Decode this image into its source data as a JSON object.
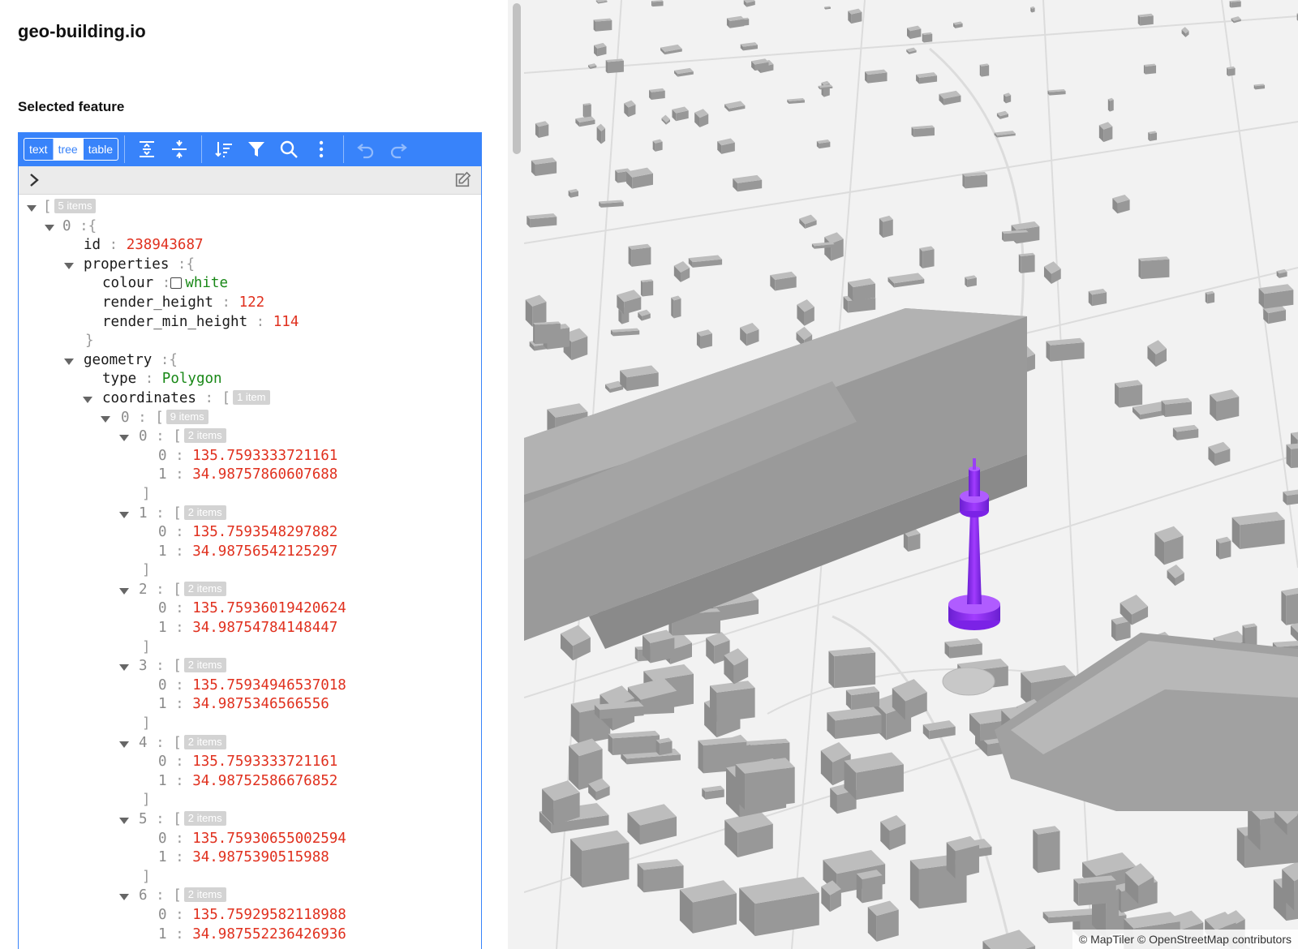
{
  "app_title": "geo-building.io",
  "section_title": "Selected feature",
  "editor": {
    "modes": [
      "text",
      "tree",
      "table"
    ],
    "active_mode": "tree",
    "toolbar_icons": [
      "expand-all-icon",
      "collapse-all-icon",
      "sort-icon",
      "filter-icon",
      "search-icon",
      "more-icon",
      "undo-icon",
      "redo-icon"
    ],
    "accent_color": "#3883fa",
    "nav_icons": [
      "chevron-right-icon",
      "edit-icon"
    ],
    "tree": {
      "root_bracket": "[",
      "root_count": "5 items",
      "item0": {
        "index": "0",
        "bracket": "{"
      },
      "id": {
        "key": "id",
        "value": "238943687"
      },
      "properties": {
        "key": "properties",
        "bracket": "{",
        "colour_key": "colour",
        "colour_value": "white",
        "render_height_key": "render_height",
        "render_height_value": "122",
        "render_min_height_key": "render_min_height",
        "render_min_height_value": "114",
        "close": "}"
      },
      "geometry": {
        "key": "geometry",
        "bracket": "{",
        "type_key": "type",
        "type_value": "Polygon",
        "coordinates_key": "coordinates",
        "coordinates_bracket": "[",
        "coordinates_count": "1 item",
        "ring_index": "0",
        "ring_bracket": "[",
        "ring_count": "9 items"
      },
      "points": [
        {
          "index": "0",
          "count": "2 items",
          "lon": "135.7593333721161",
          "lat": "34.98757860607688"
        },
        {
          "index": "1",
          "count": "2 items",
          "lon": "135.7593548297882",
          "lat": "34.98756542125297"
        },
        {
          "index": "2",
          "count": "2 items",
          "lon": "135.75936019420624",
          "lat": "34.98754784148447"
        },
        {
          "index": "3",
          "count": "2 items",
          "lon": "135.75934946537018",
          "lat": "34.9875346566556"
        },
        {
          "index": "4",
          "count": "2 items",
          "lon": "135.7593333721161",
          "lat": "34.98752586676852"
        },
        {
          "index": "5",
          "count": "2 items",
          "lon": "135.75930655002594",
          "lat": "34.9875390515988"
        },
        {
          "index": "6",
          "count": "2 items",
          "lon": "135.75929582118988",
          "lat": "34.987552236426936"
        }
      ],
      "open_bracket": "[",
      "close_bracket": "]",
      "colon": ":",
      "sub_index_0": "0",
      "sub_index_1": "1"
    }
  },
  "map": {
    "attribution": "© MapTiler © OpenStreetMap contributors",
    "highlight_color": "#8a2be2",
    "building_color": "#a9a9a9"
  }
}
